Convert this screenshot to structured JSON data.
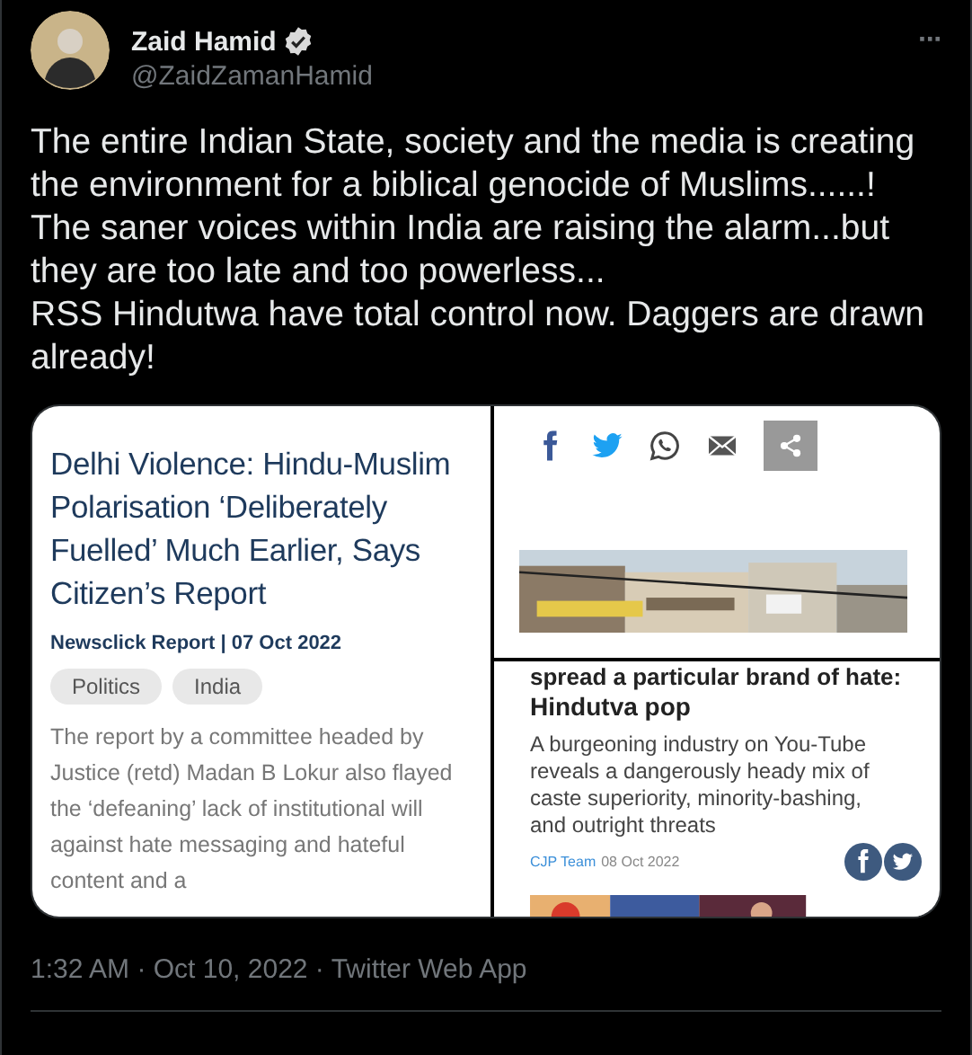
{
  "author": {
    "name": "Zaid Hamid",
    "handle": "@ZaidZamanHamid",
    "verified": true
  },
  "more_button": "···",
  "tweet_text": [
    "The entire Indian State, society and the media is creating the environment for a biblical genocide of Muslims......!",
    "The saner voices within India are raising the alarm...but they are too late and too powerless...",
    "RSS Hindutwa have total control now. Daggers are drawn already!"
  ],
  "media": {
    "left_article": {
      "headline": "Delhi Violence: Hindu-Muslim Polarisation ‘Deliberately Fuelled’ Much Earlier, Says Citizen’s Report",
      "byline": "Newsclick Report | 07 Oct 2022",
      "tags": [
        "Politics",
        "India"
      ],
      "summary": "The report by a committee headed by Justice (retd) Madan B Lokur also flayed the ‘defeaning’ lack of institutional will against hate messaging and hateful content and a"
    },
    "share_bar": [
      {
        "kind": "facebook"
      },
      {
        "kind": "twitter"
      },
      {
        "kind": "whatsapp"
      },
      {
        "kind": "mail"
      },
      {
        "kind": "share"
      }
    ],
    "right_article": {
      "headline_cut": "spread a particular brand of hate:",
      "headline": "Hindutva pop",
      "summary": "A burgeoning industry on You-Tube reveals a dangerously heady mix of caste superiority, minority-bashing, and outright threats",
      "author": "CJP Team",
      "date": "08 Oct 2022",
      "share": [
        {
          "kind": "facebook"
        },
        {
          "kind": "twitter"
        }
      ]
    }
  },
  "meta": "1:32 AM · Oct 10, 2022 · Twitter Web App"
}
